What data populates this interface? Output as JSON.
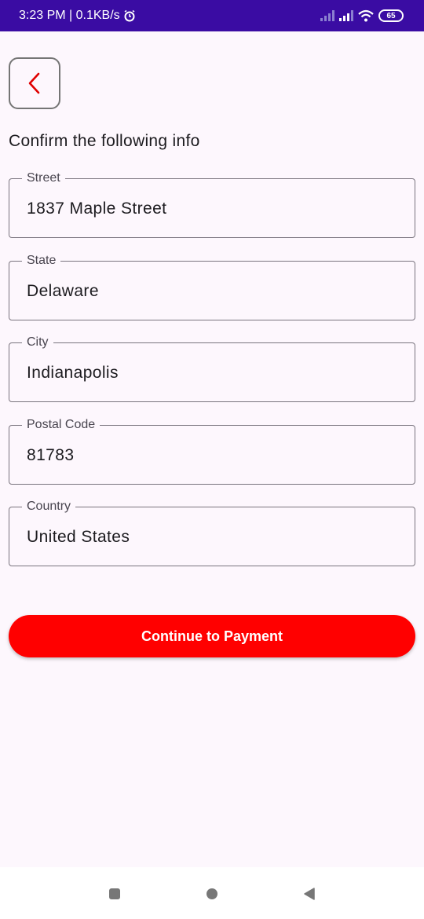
{
  "status_bar": {
    "time_speed": "3:23 PM | 0.1KB/s",
    "alarm_icon": "alarm-icon",
    "battery": "65"
  },
  "back_button": {
    "icon": "chevron-left-icon",
    "color": "#e00000"
  },
  "heading": "Confirm the following info",
  "fields": [
    {
      "label": "Street",
      "value": "1837 Maple Street"
    },
    {
      "label": "State",
      "value": "Delaware"
    },
    {
      "label": "City",
      "value": "Indianapolis"
    },
    {
      "label": "Postal Code",
      "value": "81783"
    },
    {
      "label": "Country",
      "value": "United States"
    }
  ],
  "cta": {
    "label": "Continue to Payment",
    "color": "#ff0000"
  },
  "colors": {
    "status_bar": "#3a0ca3",
    "background": "#fdf7fd"
  }
}
